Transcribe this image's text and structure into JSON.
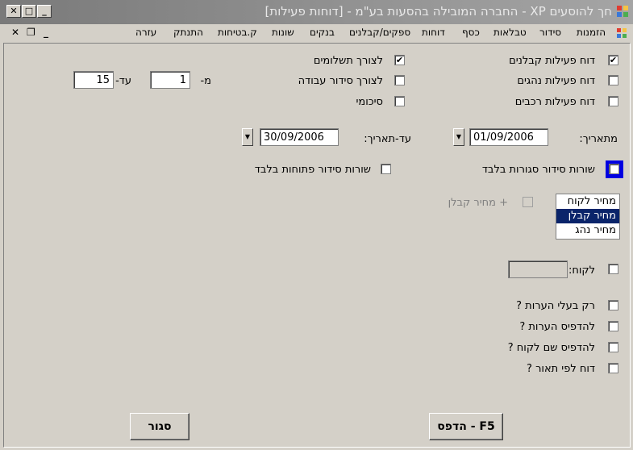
{
  "window": {
    "title": "חך להוסעים XP - החברה המובילה בהסעות בע\"מ - [דוחות פעילות]",
    "btn_close": "✕",
    "btn_max": "□",
    "btn_min": "_"
  },
  "menubar": {
    "items": [
      "הזמנות",
      "סידור",
      "טבלאות",
      "כסף",
      "דוחות",
      "ספקים/קבלנים",
      "בנקים",
      "שונות",
      "ק.בטיחות",
      "התנתק",
      "עזרה"
    ],
    "mdi_close": "✕",
    "mdi_restore": "❐",
    "mdi_min": "_"
  },
  "reports": {
    "contractors": {
      "label": "דוח פעילות קבלנים",
      "checked": true
    },
    "drivers": {
      "label": "דוח פעילות נהגים",
      "checked": false
    },
    "vehicles": {
      "label": "דוח פעילות רכבים",
      "checked": false
    }
  },
  "purposes": {
    "payments": {
      "label": "לצורך תשלומים",
      "checked": true
    },
    "work_order": {
      "label": "לצורך סידור עבודה",
      "checked": false
    },
    "summary": {
      "label": "סיכומי",
      "checked": false
    }
  },
  "range": {
    "from_label": "מ-",
    "from_value": "1",
    "to_label": "עד-",
    "to_value": "15"
  },
  "dates": {
    "from_label": "מתאריך:",
    "from_value": "01/09/2006",
    "to_label": "עד-תאריך:",
    "to_value": "30/09/2006"
  },
  "lines": {
    "closed": {
      "label": "שורות סידור סגורות בלבד",
      "checked": false
    },
    "open": {
      "label": "שורות סידור פתוחות בלבד",
      "checked": false
    }
  },
  "price_list": {
    "options": [
      "מחיר לקוח",
      "מחיר קבלן",
      "מחיר נהג"
    ],
    "selected": "מחיר קבלן"
  },
  "plus_contractor": {
    "label": "+ מחיר קבלן",
    "checked": false
  },
  "customer": {
    "label": "לקוח:",
    "value": "",
    "checked": false
  },
  "options": [
    {
      "label": "רק בעלי הערות ?",
      "checked": false
    },
    {
      "label": "להדפיס הערות ?",
      "checked": false
    },
    {
      "label": "להדפיס שם לקוח ?",
      "checked": false
    },
    {
      "label": "דוח לפי תאור ?",
      "checked": false
    }
  ],
  "buttons": {
    "print": "הדפס - F5",
    "close": "סגור"
  },
  "marks": {
    "checked": "✔",
    "unchecked": "",
    "dropdown": "▼"
  }
}
